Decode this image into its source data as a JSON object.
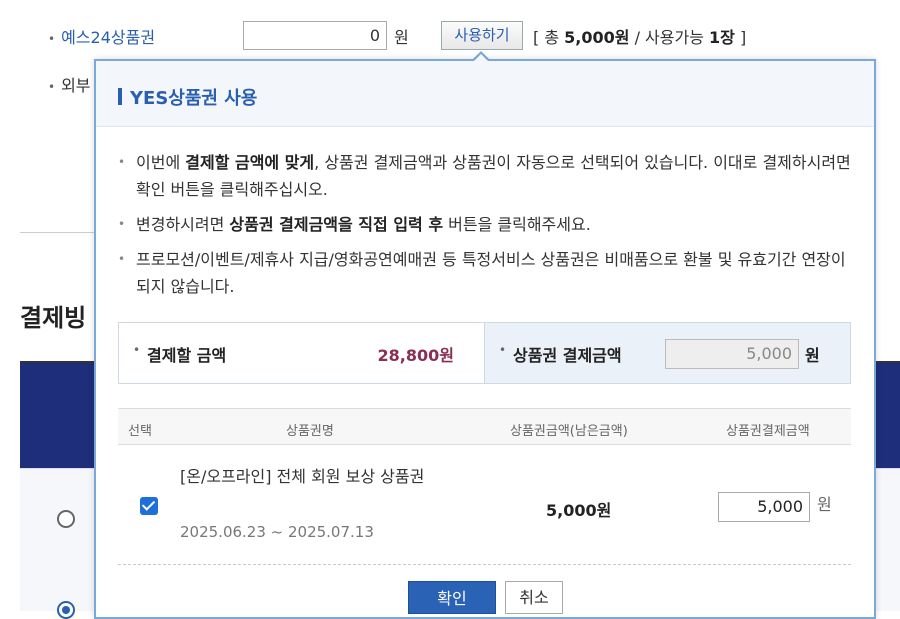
{
  "background": {
    "yes24_label": "예스24상품권",
    "voucher_value": "0",
    "won": "원",
    "use_button": "사용하기",
    "summary_prefix": "[ 총 ",
    "summary_total": "5,000원",
    "summary_mid": " / 사용가능 ",
    "summary_count": "1장",
    "summary_suffix": " ]",
    "external_label_partial": "외부",
    "section_title_partial": "결제빙"
  },
  "popup": {
    "title": "YES상품권 사용",
    "notes": [
      {
        "pre": "이번에 ",
        "bold": "결제할 금액에 맞게",
        "post": ", 상품권 결제금액과 상품권이 자동으로 선택되어 있습니다. 이대로 결제하시려면 확인 버튼을 클릭해주십시오."
      },
      {
        "pre": "변경하시려면 ",
        "bold": "상품권 결제금액을 직접 입력 후",
        "post": " 버튼을 클릭해주세요."
      },
      {
        "pre": "프로모션/이벤트/제휴사 지급/영화공연예매권 등 특정서비스 상품권은 비매품으로 환불 및 유효기간 연장이 되지 않습니다.",
        "bold": "",
        "post": ""
      }
    ],
    "amount_label": "결제할 금액",
    "amount_value": "28,800원",
    "pay_label": "상품권 결제금액",
    "pay_value": "5,000",
    "pay_won": "원",
    "table": {
      "headers": [
        "선택",
        "상품권명",
        "상품권금액(남은금액)",
        "상품권결제금액"
      ],
      "rows": [
        {
          "name": "[온/오프라인] 전체 회원 보상 상품권",
          "period": "2025.06.23 ~ 2025.07.13",
          "amount": "5,000원",
          "pay": "5,000",
          "won": "원",
          "checked": true
        }
      ]
    },
    "confirm_button": "확인",
    "cancel_button": "취소"
  }
}
